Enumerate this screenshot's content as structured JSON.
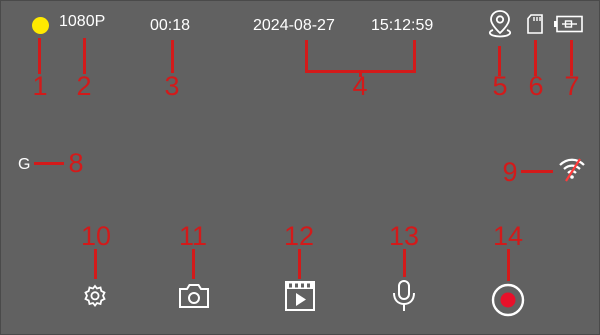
{
  "status": {
    "indicator_color": "#ffea00",
    "resolution": "1080P",
    "elapsed": "00:18",
    "date": "2024-08-27",
    "time": "15:12:59",
    "gsensor": "G"
  },
  "icons": {
    "location": "location-pin-icon",
    "sd_card": "sd-card-icon",
    "battery": "battery-charging-icon",
    "wifi": "wifi-off-icon",
    "settings": "settings-gear-icon",
    "camera": "camera-icon",
    "playback": "video-playback-icon",
    "microphone": "microphone-icon",
    "record": "record-icon"
  },
  "callouts": [
    "1",
    "2",
    "3",
    "4",
    "5",
    "6",
    "7",
    "8",
    "9",
    "10",
    "11",
    "12",
    "13",
    "14"
  ],
  "colors": {
    "callout": "#d31a1a",
    "screen_bg": "#616161",
    "record": "#e8102a"
  }
}
